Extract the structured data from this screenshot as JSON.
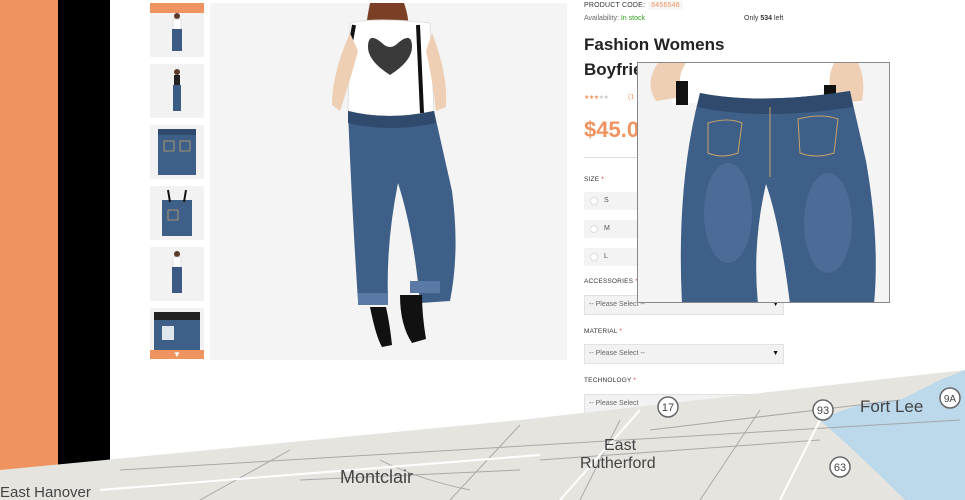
{
  "product": {
    "code_label": "PRODUCT CODE:",
    "code_value": "6456546",
    "availability_label": "Availability:",
    "availability_value": "In stock",
    "only_prefix": "Only",
    "only_count": "534",
    "only_suffix": "left",
    "title_line1": "Fashion Womens",
    "title_line2": "Boyfrie",
    "rating_stars": "★★★",
    "rating_stars_off": "★★",
    "reviews_text": "(1",
    "price": "$45.0"
  },
  "options": {
    "size_label": "SIZE",
    "sizes": [
      "S",
      "M",
      "L"
    ],
    "accessories_label": "ACCESSORIES",
    "accessories_placeholder": "-- Please Select --",
    "material_label": "MATERIAL",
    "material_placeholder": "-- Please Select --",
    "technology_label": "TECHNOLOGY",
    "technology_placeholder": "-- Please Select",
    "required_mark": "*",
    "select_arrow": "▼"
  },
  "thumbnails": {
    "down_arrow": "▼",
    "count": 6
  },
  "map": {
    "labels": [
      "Montclair",
      "East",
      "Rutherford",
      "Fort Lee",
      "East Hanover"
    ],
    "shields": [
      "17",
      "93",
      "63",
      "9A"
    ]
  },
  "colors": {
    "accent": "#ef9460",
    "stock_green": "#2da11b",
    "required_red": "#e03c3c"
  }
}
